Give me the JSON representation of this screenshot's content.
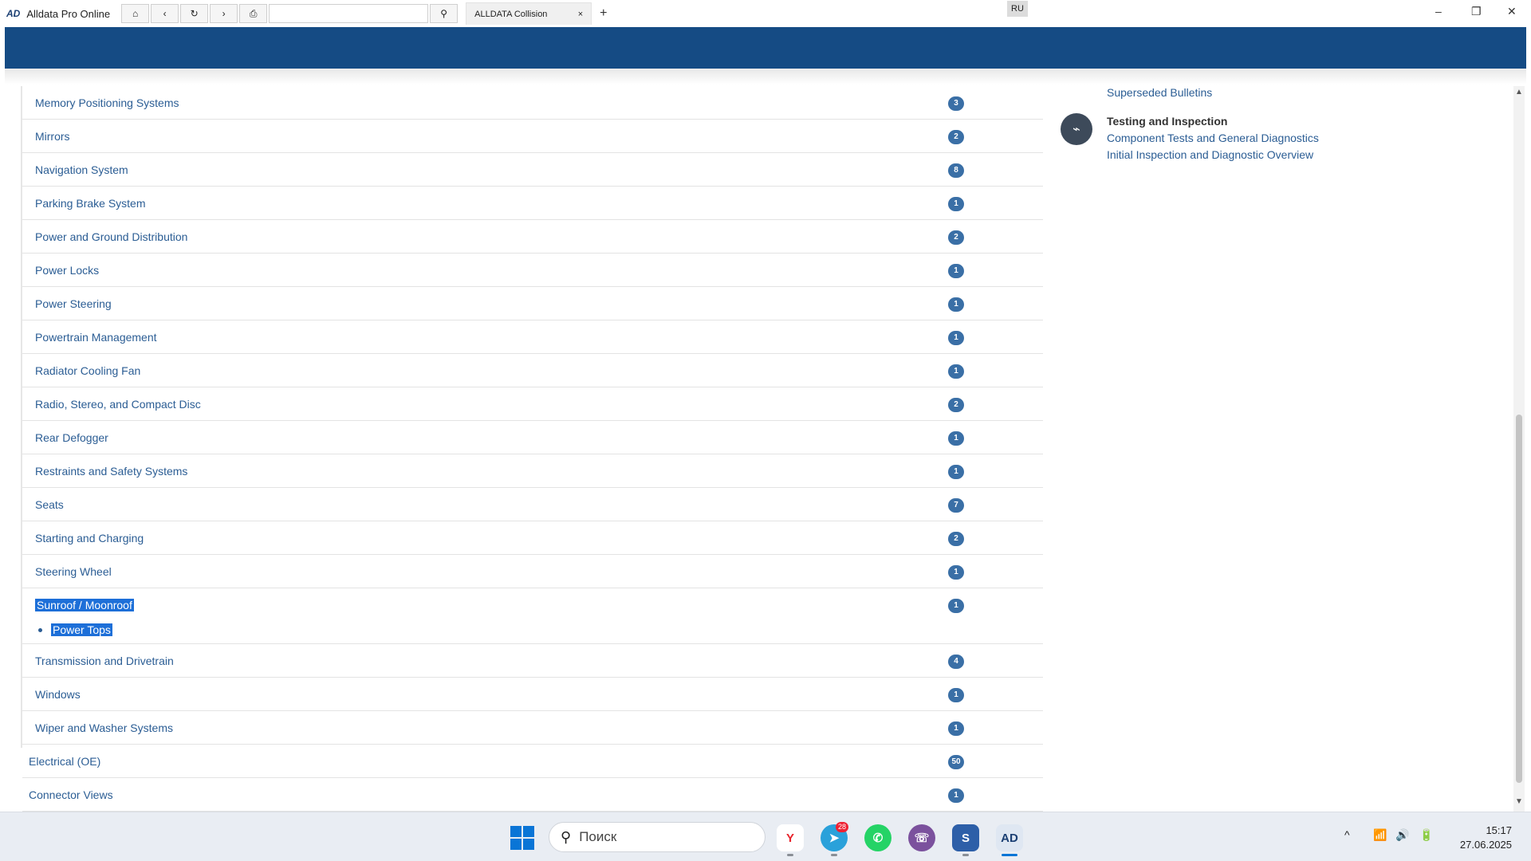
{
  "titlebar": {
    "logo": "AD",
    "app_title": "Alldata Pro Online",
    "tab_title": "ALLDATA Collision",
    "tab_close": "×",
    "tab_new": "+",
    "lang": "RU",
    "nav": {
      "home": "⌂",
      "back": "‹",
      "reload": "↻",
      "forward": "›",
      "print": "⎙",
      "search": "⚲"
    },
    "window": {
      "minimize": "–",
      "restore": "❐",
      "close": "✕"
    }
  },
  "sub_list": [
    {
      "label": "Memory Positioning Systems",
      "count": "3"
    },
    {
      "label": "Mirrors",
      "count": "2"
    },
    {
      "label": "Navigation System",
      "count": "8"
    },
    {
      "label": "Parking Brake System",
      "count": "1"
    },
    {
      "label": "Power and Ground Distribution",
      "count": "2"
    },
    {
      "label": "Power Locks",
      "count": "1"
    },
    {
      "label": "Power Steering",
      "count": "1"
    },
    {
      "label": "Powertrain Management",
      "count": "1"
    },
    {
      "label": "Radiator Cooling Fan",
      "count": "1"
    },
    {
      "label": "Radio, Stereo, and Compact Disc",
      "count": "2"
    },
    {
      "label": "Rear Defogger",
      "count": "1"
    },
    {
      "label": "Restraints and Safety Systems",
      "count": "1"
    },
    {
      "label": "Seats",
      "count": "7"
    },
    {
      "label": "Starting and Charging",
      "count": "2"
    },
    {
      "label": "Steering Wheel",
      "count": "1"
    }
  ],
  "expanded": {
    "label": "Sunroof / Moonroof",
    "count": "1",
    "sub_item": "Power Tops"
  },
  "sub_list_after": [
    {
      "label": "Transmission and Drivetrain",
      "count": "4"
    },
    {
      "label": "Windows",
      "count": "1"
    },
    {
      "label": "Wiper and Washer Systems",
      "count": "1"
    }
  ],
  "top_level": [
    {
      "label": "Electrical (OE)",
      "count": "50"
    },
    {
      "label": "Connector Views",
      "count": "1"
    }
  ],
  "right_panel": {
    "superseded": "Superseded Bulletins",
    "testing_heading": "Testing and Inspection",
    "testing_icon": "⌁",
    "links": [
      "Component Tests and General Diagnostics",
      "Initial Inspection and Diagnostic Overview"
    ]
  },
  "taskbar": {
    "search_placeholder": "Поиск",
    "telegram_badge": "28",
    "time": "15:17",
    "date": "27.06.2025",
    "tray": {
      "chevron": "^",
      "wifi": "📶",
      "volume": "🔊",
      "battery": "🔋"
    },
    "apps": {
      "yandex": "Y",
      "telegram": "➤",
      "whatsapp": "✆",
      "viber": "☏",
      "shield": "S",
      "alldata": "AD"
    }
  }
}
